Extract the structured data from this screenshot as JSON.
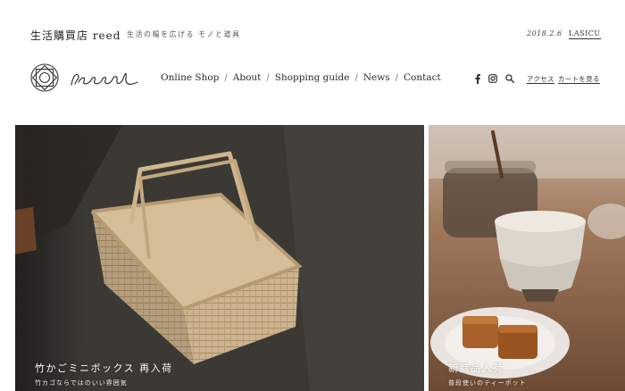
{
  "top_bar": {
    "shop_name": "生活購買店 reed",
    "tagline": "生活の幅を広げる モノと道具",
    "date": "2018.2.6",
    "link": "LASICU"
  },
  "header": {
    "nav": [
      {
        "label": "Online Shop"
      },
      {
        "label": "About"
      },
      {
        "label": "Shopping guide"
      },
      {
        "label": "News"
      },
      {
        "label": "Contact"
      }
    ],
    "nav_separator": "/",
    "icons": [
      "facebook-icon",
      "instagram-icon",
      "search-icon"
    ],
    "access_label": "アクセス",
    "cart_label": "カートを見る"
  },
  "hero": {
    "title": "竹かごミニボックス 再入荷",
    "subtitle": "竹カゴならではのいい雰囲気"
  },
  "side_feature": {
    "title": "新商品入荷",
    "subtitle": "普段使いのティーポット"
  },
  "colors": {
    "background": "#ffffff",
    "text": "#2a2a2a",
    "caption": "#ffffff"
  }
}
